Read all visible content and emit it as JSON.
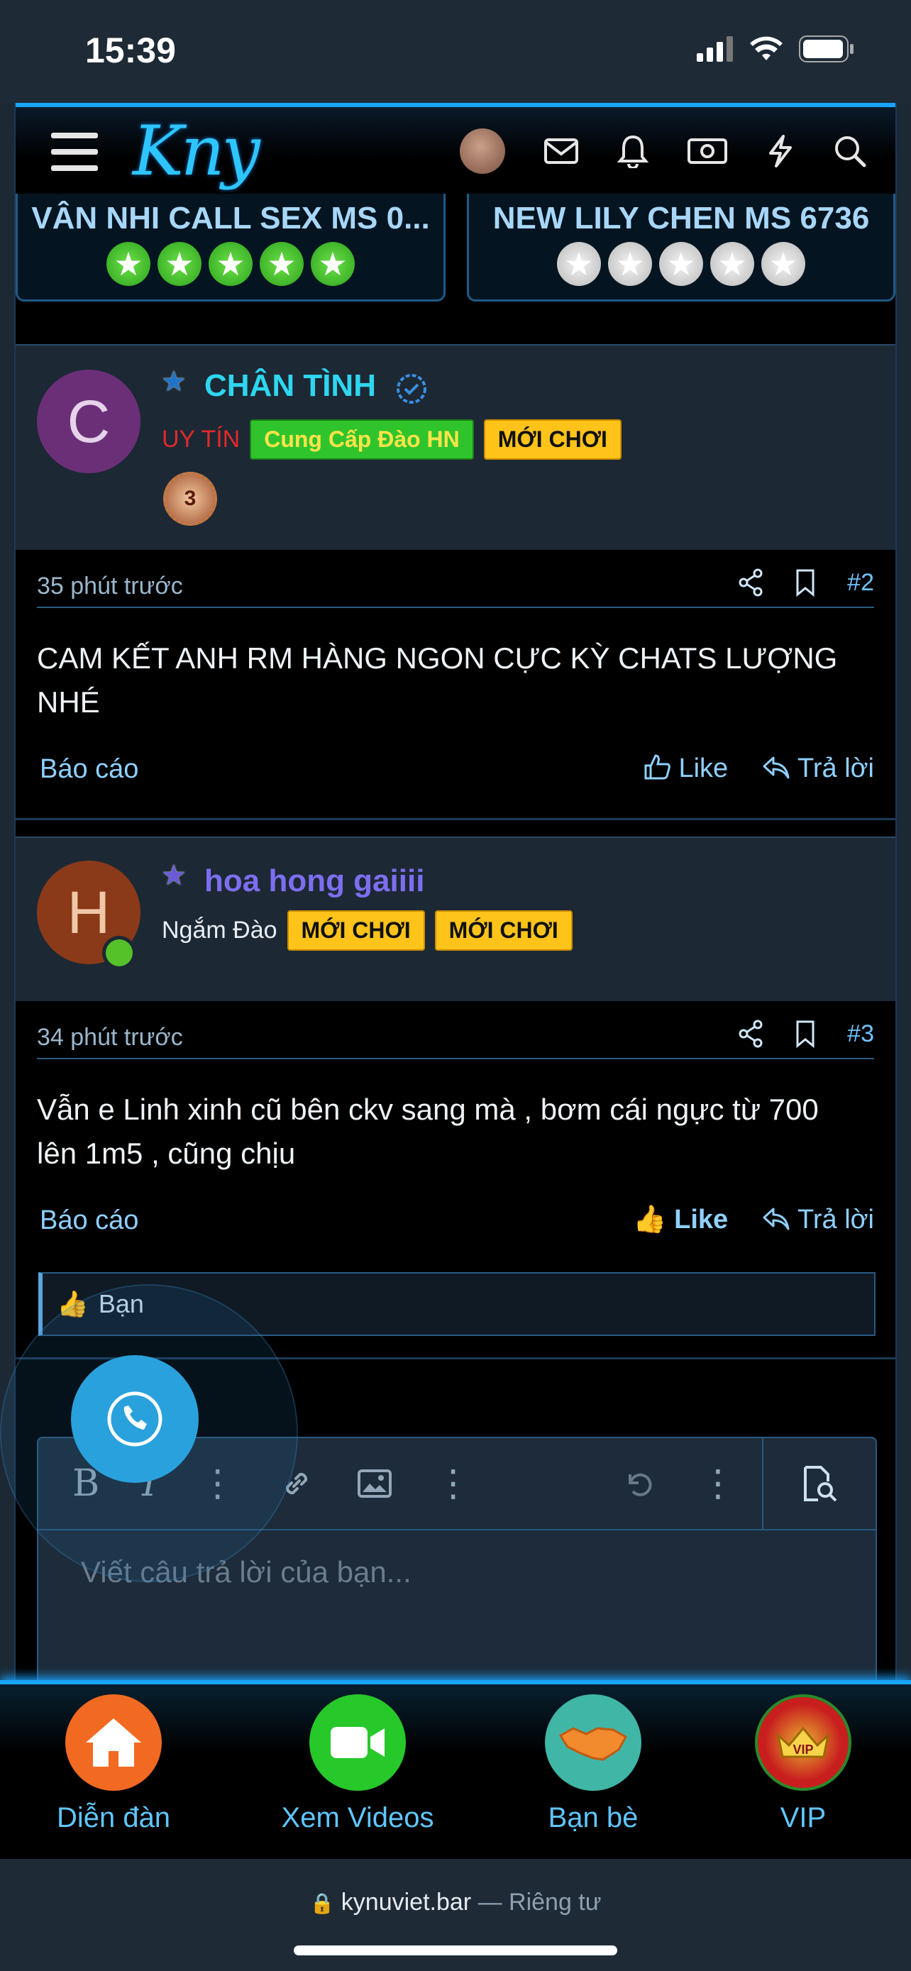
{
  "status": {
    "time": "15:39"
  },
  "header": {
    "logo": "Kny"
  },
  "cards": [
    {
      "title": "VÂN NHI CALL SEX MS 0...",
      "rating": 5
    },
    {
      "title": "NEW LILY CHEN MS 6736",
      "rating": 0
    }
  ],
  "posts": [
    {
      "avatar_letter": "C",
      "username": "CHÂN TÌNH",
      "role": "UY TÍN",
      "tags": [
        "Cung Cấp Đào HN",
        "MỚI CHƠI"
      ],
      "medal": "3",
      "time": "35 phút trước",
      "number": "#2",
      "body": "CAM KẾT ANH RM HÀNG NGON CỰC KỲ CHATS LƯỢNG NHÉ",
      "report": "Báo cáo",
      "like": "Like",
      "reply": "Trả lời"
    },
    {
      "avatar_letter": "H",
      "username": "hoa hong gaiiii",
      "role": "Ngắm Đào",
      "tags": [
        "MỚI CHƠI",
        "MỚI CHƠI"
      ],
      "time": "34 phút trước",
      "number": "#3",
      "body": "Vẫn e Linh xinh cũ bên ckv sang mà , bơm cái ngực từ 700 lên 1m5 , cũng chịu",
      "report": "Báo cáo",
      "like": "Like",
      "reply": "Trả lời",
      "reaction": "Bạn"
    }
  ],
  "editor": {
    "placeholder": "Viết câu trả lời của bạn..."
  },
  "bottom_nav": [
    {
      "label": "Diễn đàn",
      "icon": "home-icon",
      "color": "#f26a21"
    },
    {
      "label": "Xem Videos",
      "icon": "video-camera-icon",
      "color": "#27c82a"
    },
    {
      "label": "Bạn bè",
      "icon": "handshake-icon",
      "color": "#3fb6a6"
    },
    {
      "label": "VIP",
      "icon": "vip-crown-icon",
      "color": "#c81e1e"
    }
  ],
  "browser": {
    "domain": "kynuviet.bar",
    "privacy": "— Riêng tư"
  }
}
